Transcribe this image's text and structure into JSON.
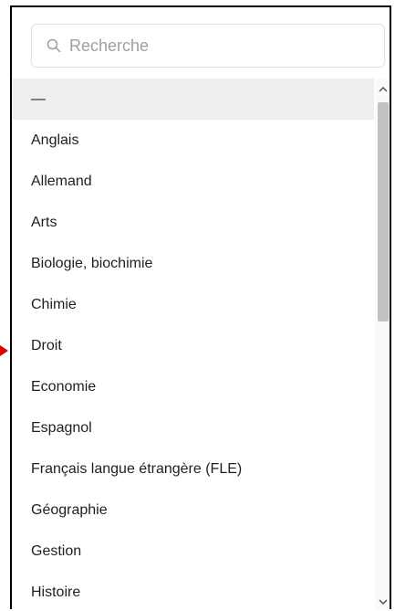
{
  "search": {
    "placeholder": "Recherche",
    "value": ""
  },
  "options": [
    "—",
    "Anglais",
    "Allemand",
    "Arts",
    "Biologie, biochimie",
    "Chimie",
    "Droit",
    "Economie",
    "Espagnol",
    "Français langue étrangère (FLE)",
    "Géographie",
    "Gestion",
    "Histoire"
  ],
  "selected_index": 0,
  "scrollbar": {
    "position_fraction": 0.0
  },
  "colors": {
    "pointer": "#e00000",
    "selected_bg": "#eeeeef",
    "thumb": "#c1c1c1"
  },
  "icons": {
    "search": "search-icon",
    "scroll_up": "chevron-up-icon",
    "scroll_down": "chevron-down-icon",
    "pointer": "red-arrow-pointer"
  }
}
